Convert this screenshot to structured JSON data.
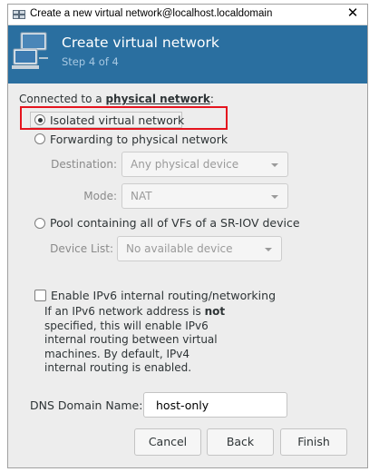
{
  "window": {
    "title": "Create a new virtual network@localhost.localdomain",
    "close_label": "✕"
  },
  "header": {
    "title": "Create virtual network",
    "step": "Step 4 of 4",
    "accent_color": "#2a6fa0"
  },
  "network": {
    "section_prefix": "Connected to a ",
    "section_bold": "physical network",
    "section_suffix": ":",
    "options": [
      {
        "label": "Isolated virtual network",
        "selected": true
      },
      {
        "label": "Forwarding to physical network",
        "selected": false
      },
      {
        "label": "Pool containing all of VFs of a SR-IOV device",
        "selected": false
      }
    ],
    "destination_label": "Destination:",
    "destination_value": "Any physical device",
    "mode_label": "Mode:",
    "mode_value": "NAT",
    "device_list_label": "Device List:",
    "device_list_value": "No available device"
  },
  "ipv6": {
    "checkbox_label": "Enable IPv6 internal routing/networking",
    "checked": false,
    "desc_lines": [
      [
        "If an IPv6 network address is ",
        "not"
      ],
      [
        "specified, this will enable IPv6",
        ""
      ],
      [
        "internal routing between virtual",
        ""
      ],
      [
        "machines.  By default, IPv4",
        ""
      ],
      [
        "internal routing is enabled.",
        ""
      ]
    ]
  },
  "dns": {
    "label": "DNS Domain Name:",
    "value": "host-only"
  },
  "buttons": {
    "cancel": "Cancel",
    "back": "Back",
    "finish": "Finish"
  },
  "highlight_color": "#e5141e"
}
